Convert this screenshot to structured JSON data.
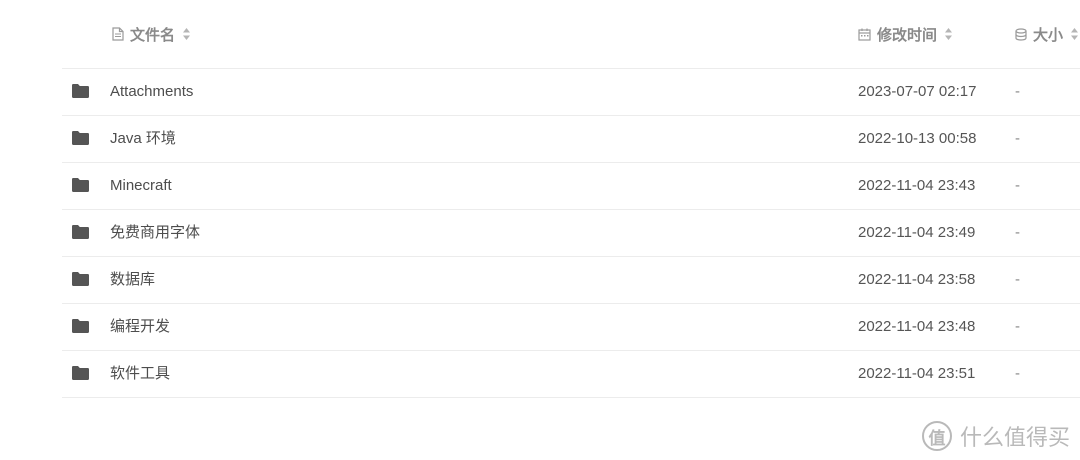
{
  "header": {
    "name_label": "文件名",
    "time_label": "修改时间",
    "size_label": "大小",
    "name_icon": "file-icon",
    "time_icon": "calendar-icon",
    "size_icon": "database-icon",
    "sort_icon": "sort-icon"
  },
  "rows": [
    {
      "icon": "folder-icon",
      "name": "Attachments",
      "time": "2023-07-07 02:17",
      "size": "-"
    },
    {
      "icon": "folder-icon",
      "name": "Java 环境",
      "time": "2022-10-13 00:58",
      "size": "-"
    },
    {
      "icon": "folder-icon",
      "name": "Minecraft",
      "time": "2022-11-04 23:43",
      "size": "-"
    },
    {
      "icon": "folder-icon",
      "name": "免费商用字体",
      "time": "2022-11-04 23:49",
      "size": "-"
    },
    {
      "icon": "folder-icon",
      "name": "数据库",
      "time": "2022-11-04 23:58",
      "size": "-"
    },
    {
      "icon": "folder-icon",
      "name": "编程开发",
      "time": "2022-11-04 23:48",
      "size": "-"
    },
    {
      "icon": "folder-icon",
      "name": "软件工具",
      "time": "2022-11-04 23:51",
      "size": "-"
    }
  ],
  "watermark": {
    "logo_text": "值",
    "text": "什么值得买"
  },
  "colors": {
    "folder": "#555555",
    "header_text": "#8a8a8a",
    "divider": "#ececec",
    "watermark": "#b9b9b9"
  }
}
